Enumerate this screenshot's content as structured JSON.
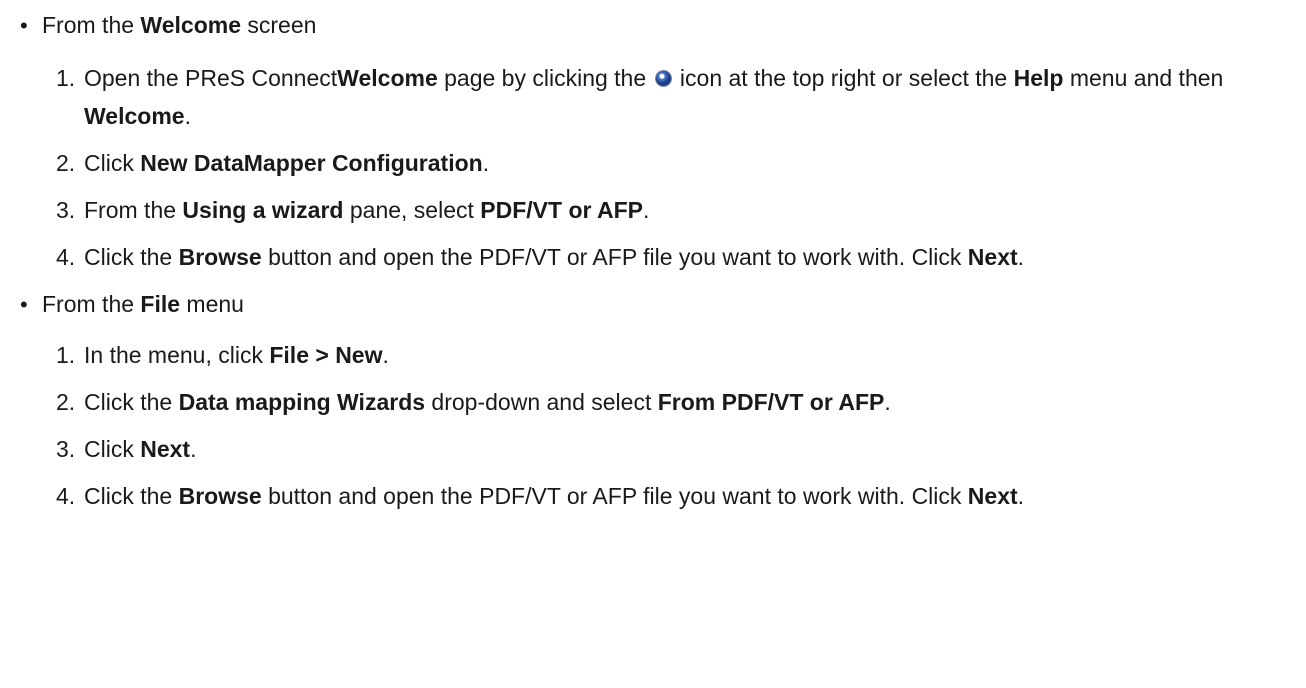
{
  "sections": [
    {
      "intro_pre": "From the ",
      "intro_bold": "Welcome",
      "intro_post": " screen",
      "steps": [
        {
          "num": "1.",
          "parts": [
            {
              "t": "Open the PReS Connect"
            },
            {
              "b": "Welcome"
            },
            {
              "t": " page by clicking the "
            },
            {
              "icon": "welcome-globe-icon"
            },
            {
              "t": " icon at the top right or select the "
            },
            {
              "b": "Help"
            },
            {
              "t": " menu and then "
            },
            {
              "b": "Welcome"
            },
            {
              "t": "."
            }
          ]
        },
        {
          "num": "2.",
          "parts": [
            {
              "t": "Click "
            },
            {
              "b": "New DataMapper Configuration"
            },
            {
              "t": "."
            }
          ]
        },
        {
          "num": "3.",
          "parts": [
            {
              "t": "From the "
            },
            {
              "b": "Using a wizard"
            },
            {
              "t": " pane, select "
            },
            {
              "b": "PDF/VT or AFP"
            },
            {
              "t": "."
            }
          ]
        },
        {
          "num": "4.",
          "parts": [
            {
              "t": "Click the "
            },
            {
              "b": "Browse"
            },
            {
              "t": " button and open the PDF/VT or AFP file you want to work with. Click "
            },
            {
              "b": "Next"
            },
            {
              "t": "."
            }
          ]
        }
      ]
    },
    {
      "intro_pre": "From the ",
      "intro_bold": "File",
      "intro_post": " menu",
      "steps": [
        {
          "num": "1.",
          "parts": [
            {
              "t": "In the menu, click "
            },
            {
              "b": "File > New"
            },
            {
              "t": "."
            }
          ]
        },
        {
          "num": "2.",
          "parts": [
            {
              "t": "Click the "
            },
            {
              "b": "Data mapping Wizards"
            },
            {
              "t": " drop-down and select "
            },
            {
              "b": "From PDF/VT or AFP"
            },
            {
              "t": "."
            }
          ]
        },
        {
          "num": "3.",
          "parts": [
            {
              "t": "Click "
            },
            {
              "b": "Next"
            },
            {
              "t": "."
            }
          ]
        },
        {
          "num": "4.",
          "parts": [
            {
              "t": "Click the "
            },
            {
              "b": "Browse"
            },
            {
              "t": " button and open the PDF/VT or AFP file you want to work with. Click "
            },
            {
              "b": "Next"
            },
            {
              "t": "."
            }
          ]
        }
      ]
    }
  ]
}
